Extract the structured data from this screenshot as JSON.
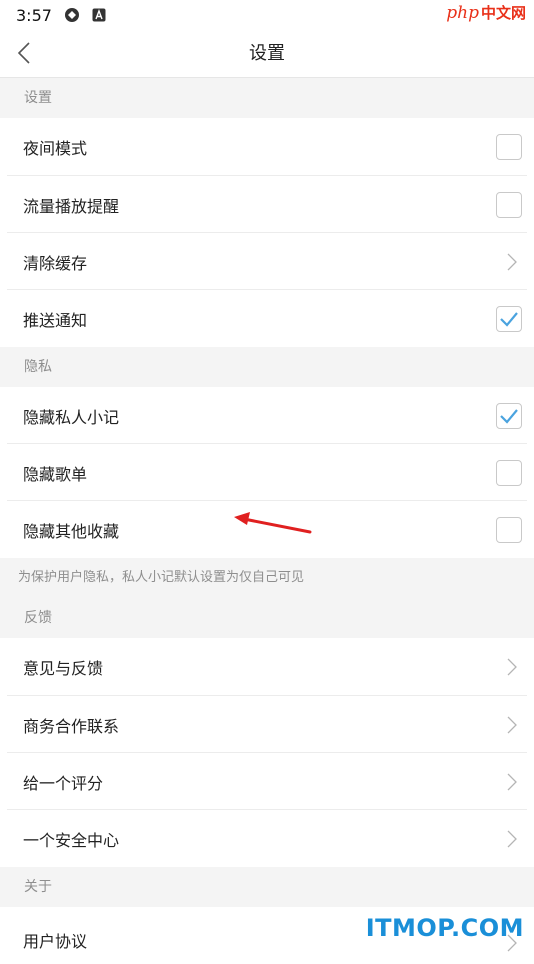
{
  "status_bar": {
    "time": "3:57"
  },
  "watermark": {
    "php_text": "php",
    "cn_text": "中文网",
    "site": "ITMOP.COM"
  },
  "nav": {
    "title": "设置"
  },
  "sections": {
    "settings": "设置",
    "privacy": "隐私",
    "feedback": "反馈",
    "about": "关于"
  },
  "settings_items": [
    {
      "label": "夜间模式",
      "control": "checkbox",
      "checked": false
    },
    {
      "label": "流量播放提醒",
      "control": "checkbox",
      "checked": false
    },
    {
      "label": "清除缓存",
      "control": "chevron"
    },
    {
      "label": "推送通知",
      "control": "checkbox",
      "checked": true
    }
  ],
  "privacy_items": [
    {
      "label": "隐藏私人小记",
      "control": "checkbox",
      "checked": true
    },
    {
      "label": "隐藏歌单",
      "control": "checkbox",
      "checked": false
    },
    {
      "label": "隐藏其他收藏",
      "control": "checkbox",
      "checked": false
    }
  ],
  "privacy_note": "为保护用户隐私，私人小记默认设置为仅自己可见",
  "feedback_items": [
    {
      "label": "意见与反馈",
      "control": "chevron"
    },
    {
      "label": "商务合作联系",
      "control": "chevron"
    },
    {
      "label": "给一个评分",
      "control": "chevron"
    },
    {
      "label": "一个安全中心",
      "control": "chevron"
    }
  ],
  "about_items": [
    {
      "label": "用户协议",
      "control": "chevron"
    }
  ],
  "colors": {
    "accent": "#4aa3df",
    "annotation_arrow": "#e02020",
    "watermark_blue": "#1a8fd8",
    "watermark_red": "#e9311a"
  }
}
